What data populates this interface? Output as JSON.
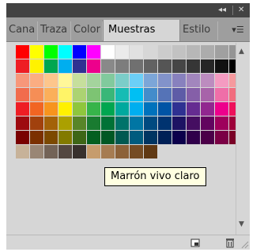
{
  "window": {
    "controls": {
      "collapse": "◂◂",
      "close": "✕"
    }
  },
  "tabs": [
    {
      "label": "Cana",
      "active": false
    },
    {
      "label": "Traza",
      "active": false
    },
    {
      "label": "Color",
      "active": false
    },
    {
      "label": "Muestras",
      "active": true
    },
    {
      "label": "Estilo",
      "active": false
    }
  ],
  "panel_menu_icon": "panel-menu-icon",
  "tooltip": {
    "text": "Marrón vivo claro"
  },
  "swatches": [
    [
      "#ff0000",
      "#ffff00",
      "#00ff00",
      "#00ffff",
      "#0000ff",
      "#ff00ff",
      "#ffffff",
      "#ebebeb",
      "#e1e1e1",
      "#d7d7d7",
      "#cccccc",
      "#c2c2c2",
      "#b7b7b7",
      "#acacac",
      "#a0a0a0",
      "#959595"
    ],
    [
      "#ee1d24",
      "#fff200",
      "#00a650",
      "#00aeef",
      "#2f3192",
      "#ed008c",
      "#898989",
      "#7d7d7d",
      "#707070",
      "#626262",
      "#555555",
      "#464646",
      "#363636",
      "#262626",
      "#111111",
      "#000000"
    ],
    [
      "#f7977a",
      "#fbad82",
      "#fdc68c",
      "#fff799",
      "#c6df9c",
      "#a4d49d",
      "#81ca9d",
      "#7bcdc9",
      "#6ccff7",
      "#7ca6d8",
      "#8293ca",
      "#8881be",
      "#a286bd",
      "#bc8cbf",
      "#f49bc1",
      "#f5999d"
    ],
    [
      "#f16c4d",
      "#f68e56",
      "#fbaf5a",
      "#fff467",
      "#acd372",
      "#7dc473",
      "#39b778",
      "#16bcb4",
      "#00bff3",
      "#438ccb",
      "#5573b7",
      "#5e5ca7",
      "#855fa8",
      "#a763a9",
      "#ef6ea8",
      "#f16d7e"
    ],
    [
      "#ee1d24",
      "#f16522",
      "#f7941d",
      "#fff100",
      "#8fc63d",
      "#37b44a",
      "#00a650",
      "#00a99e",
      "#00aeef",
      "#0072bc",
      "#0054a5",
      "#2f3192",
      "#652c91",
      "#91278f",
      "#ed008c",
      "#ee105a"
    ],
    [
      "#9d0a0f",
      "#a1410d",
      "#a36209",
      "#aba000",
      "#588528",
      "#197b30",
      "#007236",
      "#00736a",
      "#0076a4",
      "#004a80",
      "#003370",
      "#1d1363",
      "#450e61",
      "#62055f",
      "#9e005c",
      "#9d0039"
    ],
    [
      "#790000",
      "#7b3000",
      "#7c4900",
      "#827a00",
      "#3e6617",
      "#045f20",
      "#005824",
      "#005951",
      "#005b7e",
      "#003562",
      "#002056",
      "#0c004b",
      "#30004a",
      "#4b0048",
      "#7a0045",
      "#7a0026"
    ],
    [
      "#c7b299",
      "#998675",
      "#736357",
      "#534741",
      "#37302d",
      "#c69c6d",
      "#a67c52",
      "#8c6239",
      "#754c24",
      "#603913"
    ]
  ],
  "bottom_icons": [
    "new-swatch-icon",
    "trash-icon",
    "resize-grip-icon"
  ]
}
